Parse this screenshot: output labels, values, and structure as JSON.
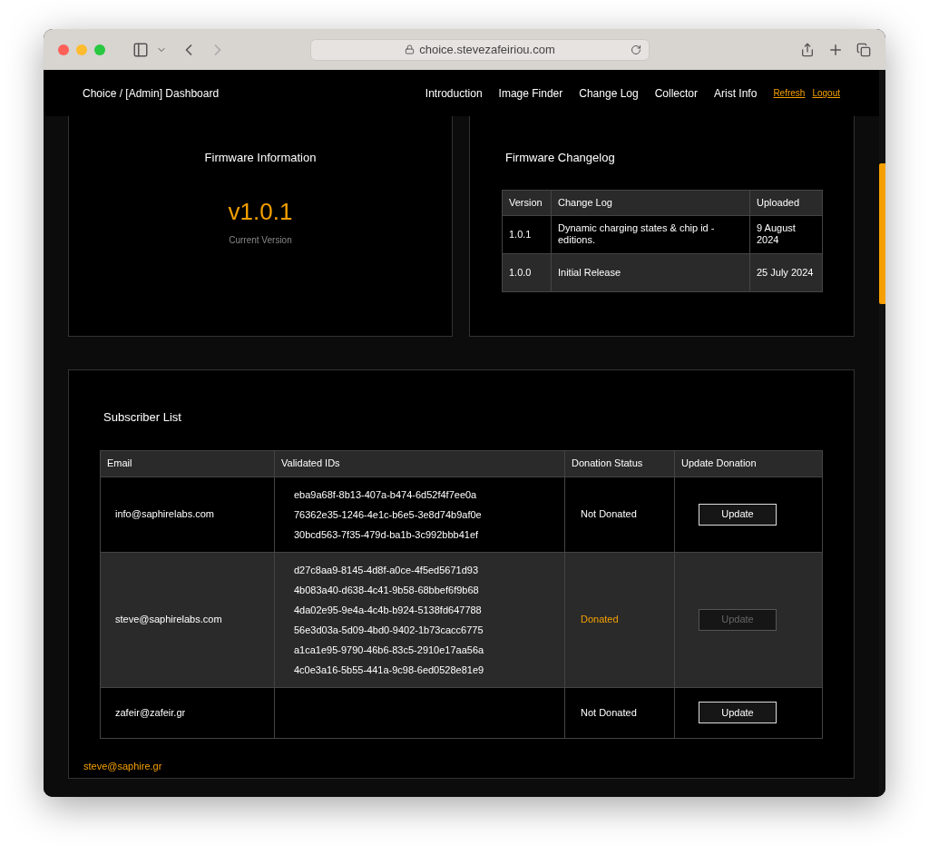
{
  "browser": {
    "url": "choice.stevezafeiriou.com"
  },
  "nav": {
    "title": "Choice / [Admin] Dashboard",
    "links": [
      "Introduction",
      "Image Finder",
      "Change Log",
      "Collector",
      "Arist Info"
    ],
    "actions": [
      "Refresh",
      "Logout"
    ]
  },
  "firmware_info": {
    "title": "Firmware Information",
    "version": "v1.0.1",
    "caption": "Current Version"
  },
  "firmware_changelog": {
    "title": "Firmware Changelog",
    "columns": [
      "Version",
      "Change Log",
      "Uploaded"
    ],
    "rows": [
      {
        "version": "1.0.1",
        "change": "Dynamic charging states & chip id - editions.",
        "uploaded": "9 August 2024"
      },
      {
        "version": "1.0.0",
        "change": "Initial Release",
        "uploaded": "25 July 2024"
      }
    ]
  },
  "subscribers": {
    "title": "Subscriber List",
    "columns": [
      "Email",
      "Validated IDs",
      "Donation Status",
      "Update Donation"
    ],
    "rows": [
      {
        "email": "info@saphirelabs.com",
        "ids": [
          "eba9a68f-8b13-407a-b474-6d52f4f7ee0a",
          "76362e35-1246-4e1c-b6e5-3e8d74b9af0e",
          "30bcd563-7f35-479d-ba1b-3c992bbb41ef"
        ],
        "status": "Not Donated",
        "donated": false,
        "button": "Update",
        "disabled": false
      },
      {
        "email": "steve@saphirelabs.com",
        "ids": [
          "d27c8aa9-8145-4d8f-a0ce-4f5ed5671d93",
          "4b083a40-d638-4c41-9b58-68bbef6f9b68",
          "4da02e95-9e4a-4c4b-b924-5138fd647788",
          "56e3d03a-5d09-4bd0-9402-1b73cacc6775",
          "a1ca1e95-9790-46b6-83c5-2910e17aa56a",
          "4c0e3a16-5b55-441a-9c98-6ed0528e81e9"
        ],
        "status": "Donated",
        "donated": true,
        "button": "Update",
        "disabled": true
      },
      {
        "email": "zafeir@zafeir.gr",
        "ids": [],
        "status": "Not Donated",
        "donated": false,
        "button": "Update",
        "disabled": false
      }
    ]
  },
  "footer": {
    "email": "steve@saphire.gr"
  }
}
